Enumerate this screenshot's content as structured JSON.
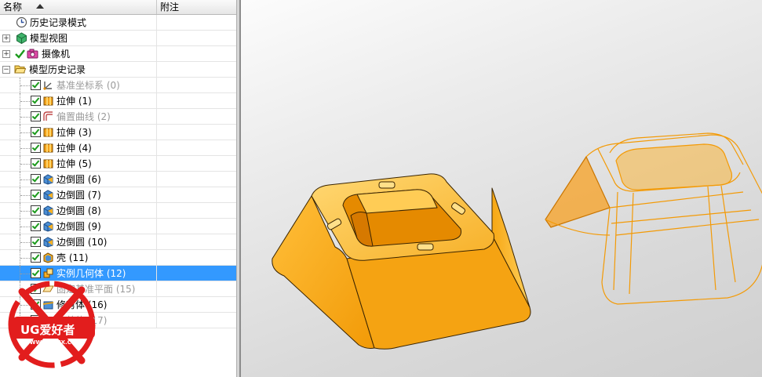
{
  "header": {
    "col_name": "名称",
    "col_note": "附注"
  },
  "tree": {
    "history_mode": "历史记录模式",
    "model_views": "模型视图",
    "camera": "摄像机",
    "model_history": "模型历史记录",
    "features": [
      {
        "label": "基准坐标系 (0)",
        "icon": "datum-csys-icon",
        "dim": true
      },
      {
        "label": "拉伸 (1)",
        "icon": "extrude-icon",
        "dim": false
      },
      {
        "label": "偏置曲线 (2)",
        "icon": "offset-curve-icon",
        "dim": true
      },
      {
        "label": "拉伸 (3)",
        "icon": "extrude-icon",
        "dim": false
      },
      {
        "label": "拉伸 (4)",
        "icon": "extrude-icon",
        "dim": false
      },
      {
        "label": "拉伸 (5)",
        "icon": "extrude-icon",
        "dim": false
      },
      {
        "label": "边倒圆 (6)",
        "icon": "edge-blend-icon",
        "dim": false
      },
      {
        "label": "边倒圆 (7)",
        "icon": "edge-blend-icon",
        "dim": false
      },
      {
        "label": "边倒圆 (8)",
        "icon": "edge-blend-icon",
        "dim": false
      },
      {
        "label": "边倒圆 (9)",
        "icon": "edge-blend-icon",
        "dim": false
      },
      {
        "label": "边倒圆 (10)",
        "icon": "edge-blend-icon",
        "dim": false
      },
      {
        "label": "壳 (11)",
        "icon": "shell-icon",
        "dim": false
      },
      {
        "label": "实例几何体 (12)",
        "icon": "instance-geometry-icon",
        "dim": false,
        "selected": true
      },
      {
        "label": "固定基准平面 (15)",
        "icon": "datum-plane-icon",
        "dim": true
      },
      {
        "label": "修剪体 (16)",
        "icon": "trim-body-icon",
        "dim": false
      },
      {
        "label": "修剪体 (17)",
        "icon": "trim-body-icon",
        "dim": true
      }
    ]
  },
  "watermark": {
    "brand": "UG爱好者",
    "url": "WWW.UGSNX.COM"
  },
  "colors": {
    "selection": "#3399ff",
    "model_orange": "#f5a623",
    "check_green": "#1c9a1c"
  }
}
